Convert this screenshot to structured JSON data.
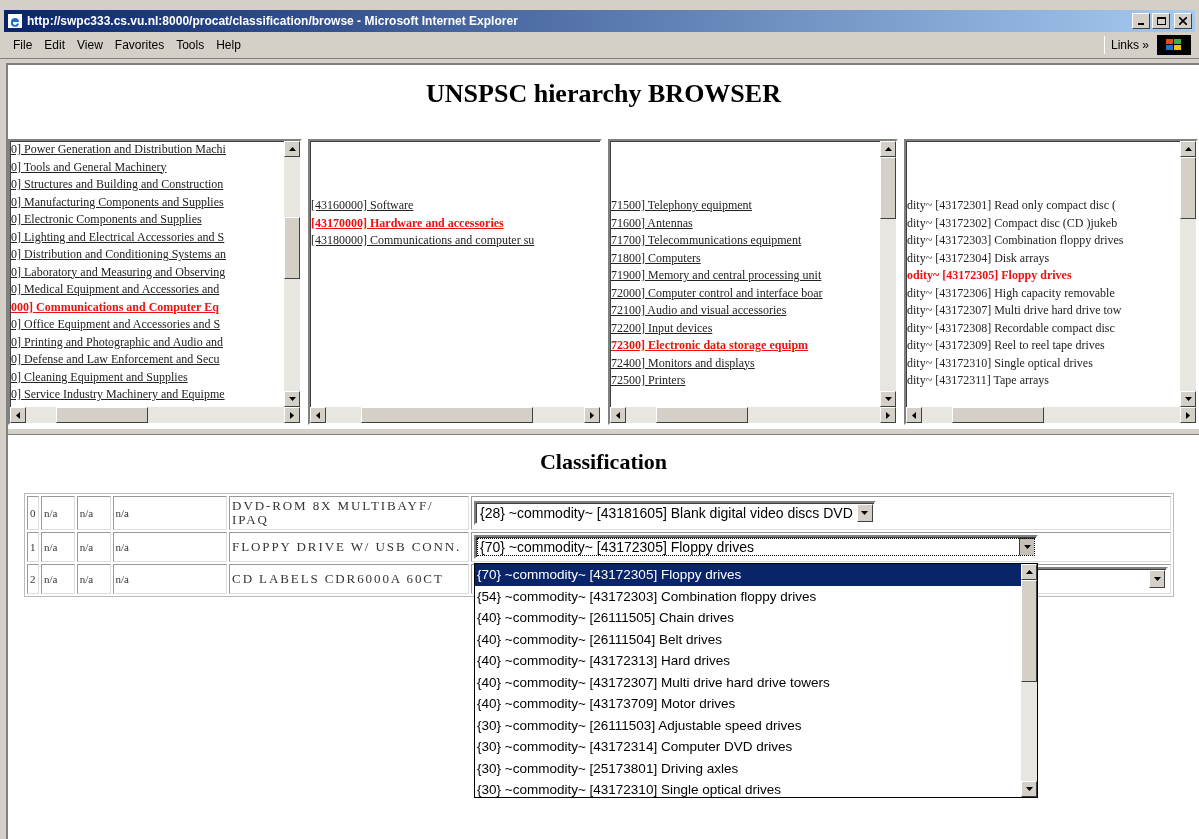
{
  "window": {
    "title": "http://swpc333.cs.vu.nl:8000/procat/classification/browse - Microsoft Internet Explorer"
  },
  "menu": [
    "File",
    "Edit",
    "View",
    "Favorites",
    "Tools",
    "Help"
  ],
  "links_label": "Links",
  "links_chevron": "»",
  "heading": "UNSPSC hierarchy BROWSER",
  "panes": [
    {
      "kind": "link",
      "lines": [
        {
          "text": "0] Power Generation and Distribution Machi",
          "selected": false
        },
        {
          "text": "0] Tools and General Machinery",
          "selected": false
        },
        {
          "text": "0] Structures and Building and Construction",
          "selected": false
        },
        {
          "text": "0] Manufacturing Components and Supplies",
          "selected": false
        },
        {
          "text": "0] Electronic Components and Supplies",
          "selected": false
        },
        {
          "text": "0] Lighting and Electrical Accessories and S",
          "selected": false
        },
        {
          "text": "0] Distribution and Conditioning Systems an",
          "selected": false
        },
        {
          "text": "0] Laboratory and Measuring and Observing",
          "selected": false
        },
        {
          "text": "0] Medical Equipment and Accessories and",
          "selected": false
        },
        {
          "text": "000] Communications and Computer Eq",
          "selected": true
        },
        {
          "text": "0] Office Equipment and Accessories and S",
          "selected": false
        },
        {
          "text": "0] Printing and Photographic and Audio and",
          "selected": false
        },
        {
          "text": "0] Defense and Law Enforcement and Secu",
          "selected": false
        },
        {
          "text": "0] Cleaning Equipment and Supplies",
          "selected": false
        },
        {
          "text": "0] Service Industry Machinery and Equipme",
          "selected": false
        }
      ]
    },
    {
      "kind": "link",
      "lines": [
        {
          "text": "[43160000] Software",
          "selected": false
        },
        {
          "text": "[43170000] Hardware and accessories",
          "selected": true
        },
        {
          "text": "[43180000] Communications and computer su",
          "selected": false
        }
      ]
    },
    {
      "kind": "link",
      "lines": [
        {
          "text": "71500] Telephony equipment",
          "selected": false
        },
        {
          "text": "71600] Antennas",
          "selected": false
        },
        {
          "text": "71700] Telecommunications equipment",
          "selected": false
        },
        {
          "text": "71800] Computers",
          "selected": false
        },
        {
          "text": "71900] Memory and central processing unit",
          "selected": false
        },
        {
          "text": "72000] Computer control and interface boar",
          "selected": false
        },
        {
          "text": "72100] Audio and visual accessories",
          "selected": false
        },
        {
          "text": "72200] Input devices",
          "selected": false
        },
        {
          "text": "72300] Electronic data storage equipm",
          "selected": true
        },
        {
          "text": "72400] Monitors and displays",
          "selected": false
        },
        {
          "text": "72500] Printers",
          "selected": false
        }
      ]
    },
    {
      "kind": "plain",
      "lines": [
        {
          "text": "dity~ [43172301] Read only compact disc (",
          "selected": false
        },
        {
          "text": "dity~ [43172302] Compact disc (CD )jukeb",
          "selected": false
        },
        {
          "text": "dity~ [43172303] Combination floppy drives",
          "selected": false
        },
        {
          "text": "dity~ [43172304] Disk arrays",
          "selected": false
        },
        {
          "text": "odity~ [43172305] Floppy drives",
          "selected": true
        },
        {
          "text": "dity~ [43172306] High capacity removable",
          "selected": false
        },
        {
          "text": "dity~ [43172307] Multi drive hard drive tow",
          "selected": false
        },
        {
          "text": "dity~ [43172308] Recordable compact disc",
          "selected": false
        },
        {
          "text": "dity~ [43172309] Reel to reel tape drives",
          "selected": false
        },
        {
          "text": "dity~ [43172310] Single optical drives",
          "selected": false
        },
        {
          "text": "dity~ [43172311] Tape arrays",
          "selected": false
        }
      ]
    }
  ],
  "classification_heading": "Classification",
  "rows": [
    {
      "cells": [
        "0",
        "n/a",
        "n/a",
        "n/a",
        "DVD-ROM 8X MULTIBAYF/ IPAQ"
      ],
      "select": {
        "value": "{28} ~commodity~ [43181605] Blank digital video discs DVD"
      }
    },
    {
      "cells": [
        "1",
        "n/a",
        "n/a",
        "n/a",
        "FLOPPY DRIVE W/ USB CONN."
      ],
      "select": {
        "value": "{70} ~commodity~ [43172305] Floppy drives",
        "expanded": true,
        "options": [
          {
            "text": "{70} ~commodity~ [43172305] Floppy drives",
            "selected": true
          },
          {
            "text": "{54} ~commodity~ [43172303] Combination floppy drives",
            "selected": false
          },
          {
            "text": "{40} ~commodity~ [26111505] Chain drives",
            "selected": false
          },
          {
            "text": "{40} ~commodity~ [26111504] Belt drives",
            "selected": false
          },
          {
            "text": "{40} ~commodity~ [43172313] Hard drives",
            "selected": false
          },
          {
            "text": "{40} ~commodity~ [43172307] Multi drive hard drive towers",
            "selected": false
          },
          {
            "text": "{40} ~commodity~ [43173709] Motor drives",
            "selected": false
          },
          {
            "text": "{30} ~commodity~ [26111503] Adjustable speed drives",
            "selected": false
          },
          {
            "text": "{30} ~commodity~ [43172314] Computer DVD drives",
            "selected": false
          },
          {
            "text": "{30} ~commodity~ [25173801] Driving axles",
            "selected": false
          },
          {
            "text": "{30} ~commodity~ [43172310] Single optical drives",
            "selected": false
          }
        ]
      }
    },
    {
      "cells": [
        "2",
        "n/a",
        "n/a",
        "n/a",
        "CD LABELS CDR6000A 60CT"
      ],
      "select": {}
    }
  ]
}
